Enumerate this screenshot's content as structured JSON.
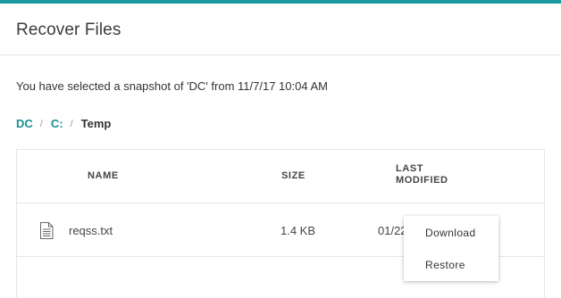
{
  "colors": {
    "accent": "#1a9aa0",
    "link": "#1a8f96"
  },
  "header": {
    "title": "Recover Files"
  },
  "snapshot_info": "You have selected a snapshot of 'DC' from 11/7/17 10:04 AM",
  "breadcrumb": {
    "items": [
      {
        "label": "DC"
      },
      {
        "label": "C:"
      }
    ],
    "separator": "/",
    "current": "Temp"
  },
  "table": {
    "columns": {
      "name": "NAME",
      "size": "SIZE",
      "modified_line1": "LAST",
      "modified_line2": "MODIFIED"
    },
    "rows": [
      {
        "icon": "document-icon",
        "name": "reqss.txt",
        "size": "1.4 KB",
        "modified": "01/22"
      }
    ]
  },
  "context_menu": {
    "items": [
      {
        "label": "Download"
      },
      {
        "label": "Restore"
      }
    ]
  }
}
